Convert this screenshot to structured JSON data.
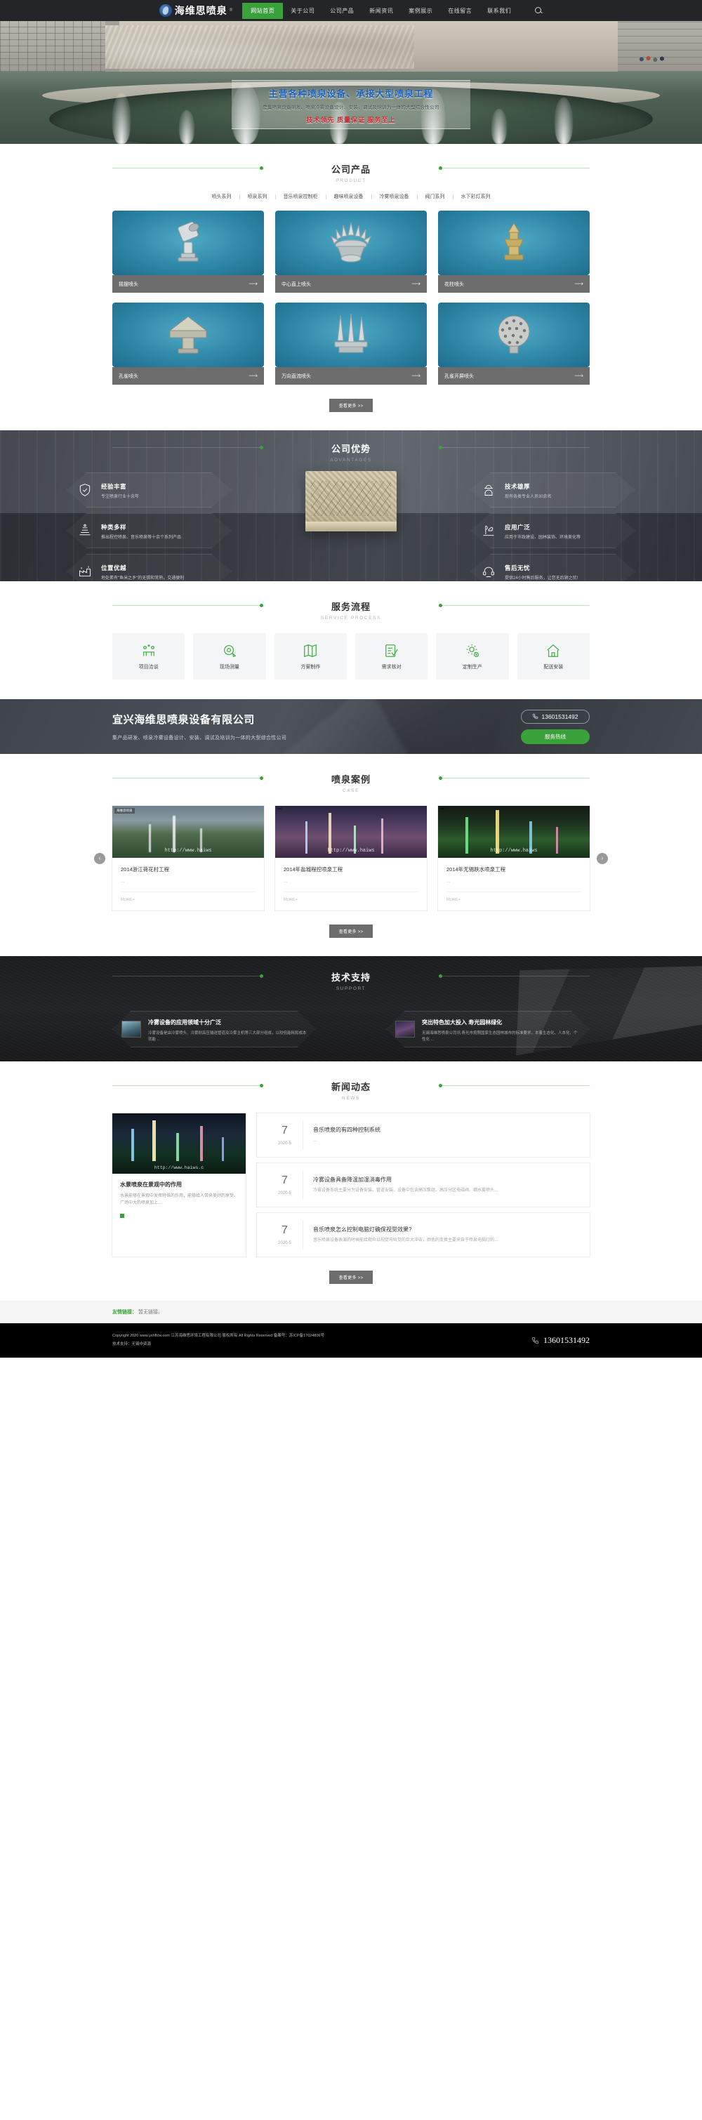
{
  "header": {
    "logo_text": "海维思喷泉",
    "logo_reg": "®",
    "nav": [
      {
        "label": "网站首页",
        "active": true
      },
      {
        "label": "关于公司",
        "active": false
      },
      {
        "label": "公司产品",
        "active": false
      },
      {
        "label": "新闻资讯",
        "active": false
      },
      {
        "label": "案例展示",
        "active": false
      },
      {
        "label": "在线留言",
        "active": false
      },
      {
        "label": "联系我们",
        "active": false
      }
    ],
    "search_icon": "search-icon"
  },
  "hero": {
    "headline": "主营各种喷泉设备、承接大型喷泉工程",
    "subline": "是集喷泉设备研发、喷泉冷雾设备设计、安装、调试及培训为一体的大型综合性公司",
    "slogan": "技术领先 质量保证 服务至上"
  },
  "product": {
    "title_cn": "公司产品",
    "title_en": "PRODUCT",
    "tabs": [
      "喷头系列",
      "喷泉系列",
      "音乐喷泉控制柜",
      "趣味喷泉设备",
      "冷雾喷泉设备",
      "阀门系列",
      "水下彩灯系列"
    ],
    "items": [
      {
        "name": "摇摆喷头",
        "arrow": "⟶"
      },
      {
        "name": "中心直上喷头",
        "arrow": "⟶"
      },
      {
        "name": "花柱喷头",
        "arrow": "⟶"
      },
      {
        "name": "孔雀喷头",
        "arrow": "⟶"
      },
      {
        "name": "万向直流喷头",
        "arrow": "⟶"
      },
      {
        "name": "孔雀开屏喷头",
        "arrow": "⟶"
      }
    ],
    "more_label": "查看更多 >>"
  },
  "advantages": {
    "title_cn": "公司优势",
    "title_en": "ADVANTAGES",
    "left": [
      {
        "title": "经验丰富",
        "desc": "专注喷泉行业十余年",
        "icon": "shield-check-icon"
      },
      {
        "title": "种类多样",
        "desc": "推出程控喷泉、音乐喷泉等十余个系列产品",
        "icon": "fountain-icon"
      },
      {
        "title": "位置优越",
        "desc": "地处素有\"鱼米之乡\"的无锡和常熟，交通便利",
        "icon": "factory-icon"
      }
    ],
    "right": [
      {
        "title": "技术雄厚",
        "desc": "现有各类专业人员30余名",
        "icon": "worker-icon"
      },
      {
        "title": "应用广泛",
        "desc": "应用于市政建设、园林装饰、环境美化等",
        "icon": "park-icon"
      },
      {
        "title": "售后无忧",
        "desc": "提供24小时售后服务，让您无后顾之忧!",
        "icon": "headset-icon"
      }
    ]
  },
  "service": {
    "title_cn": "服务流程",
    "title_en": "SERVICE PROCESS",
    "steps": [
      {
        "label": "项目洽谈",
        "icon": "negotiation-icon"
      },
      {
        "label": "现场测量",
        "icon": "tape-measure-icon"
      },
      {
        "label": "方案制作",
        "icon": "map-plan-icon"
      },
      {
        "label": "需求核对",
        "icon": "checklist-icon"
      },
      {
        "label": "定制生产",
        "icon": "gear-plus-icon"
      },
      {
        "label": "配送安装",
        "icon": "home-icon"
      }
    ]
  },
  "cta": {
    "company": "宜兴海维思喷泉设备有限公司",
    "desc": "集产品研发、喷泉冷雾设备设计、安装、调试及培训为一体的大型综合性公司",
    "phone": "13601531492",
    "phone_icon": "phone-icon",
    "button": "服务热线"
  },
  "cases": {
    "title_cn": "喷泉案例",
    "title_en": "CASE",
    "prev_icon": "chevron-left-icon",
    "next_icon": "chevron-right-icon",
    "items": [
      {
        "title": "2014浙江荷花村工程",
        "dots": "...",
        "more": "MORE+",
        "tagline": "海维思喷泉",
        "watermark": "http://www.haiws"
      },
      {
        "title": "2014年盐城程控喷泉工程",
        "dots": "...",
        "more": "MORE+",
        "tagline": "",
        "watermark": "http://www.haiws"
      },
      {
        "title": "2014年无锡跌水喷泉工程",
        "dots": "...",
        "more": "MORE+",
        "tagline": "",
        "watermark": "http://www.haiws"
      }
    ],
    "more_label": "查看更多 >>"
  },
  "support": {
    "title_cn": "技术支持",
    "title_en": "SUPPORT",
    "items": [
      {
        "title": "冷雾设备的应用领域十分广泛",
        "desc": "冷雾设备是由冷雾喷头、冷雾耐高压输送管道及冷雾主机等三大部分组成，以较低能耗和成本就能 ..."
      },
      {
        "title": "突出特色加大投入 寿光园林绿化",
        "desc": "无锡海维思喷泉公司讯:寿光市按照国家生态园林城市的标准要求，本着生态化、人本化、个性化 ..."
      }
    ]
  },
  "news": {
    "title_cn": "新闻动态",
    "title_en": "NEWS",
    "feature": {
      "title": "水景喷泉在景观中的作用",
      "desc": "水景能够在景观中发挥特殊的作用，能够给人带来美好的享受。广场中大的喷泉加上...",
      "watermark": "http://www.haiws.c"
    },
    "items": [
      {
        "day": "7",
        "month": "2020-5",
        "title": "音乐喷泉的有四种控制系统",
        "desc": "..."
      },
      {
        "day": "7",
        "month": "2020-5",
        "title": "冷雾设备具备降温加湿消毒作用",
        "desc": "冷雾设备系统主要分为设备安装、管道安装、设备中包含高压泵组、高压分区电磁阀、细水雾喷头..."
      },
      {
        "day": "7",
        "month": "2020-5",
        "title": "音乐喷泉怎么控制电脑灯确保视觉效果?",
        "desc": "音乐喷泉设备表演的时候能给观众以视觉与听觉的巨大冲击，颜色的变换主要来自于喷泉电脑灯的..."
      }
    ],
    "more_label": "查看更多 >>"
  },
  "footer": {
    "links_label": "友情链接：",
    "links_value": "暂无链接。",
    "copyright_line1": "Copyright 2020 www.yxhftcw.com 江苏海维思环境工程有限公司 版权所有 All Rights Reserved 备案号：苏ICP备17024806号",
    "copyright_line2": "技术支持：无锡中资源",
    "phone": "13601531492",
    "phone_icon": "phone-icon"
  },
  "colors": {
    "accent_green": "#3aa23a",
    "dark_header": "#242528",
    "caption_gray": "#6d6d6d",
    "hero_blue": "#1d5fb5",
    "hero_red": "#c4262e"
  }
}
